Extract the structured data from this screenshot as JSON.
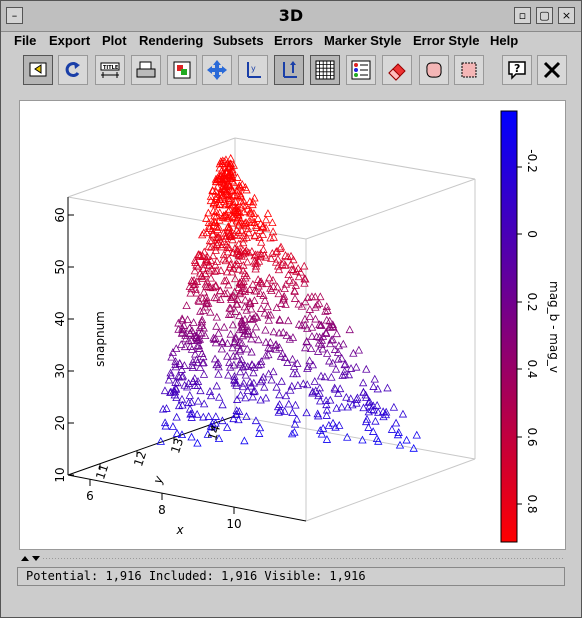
{
  "window": {
    "title": "3D"
  },
  "menu": [
    {
      "label": "File"
    },
    {
      "label": "Export"
    },
    {
      "label": "Plot"
    },
    {
      "label": "Rendering"
    },
    {
      "label": "Subsets"
    },
    {
      "label": "Errors"
    },
    {
      "label": "Marker Style"
    },
    {
      "label": "Error Style"
    },
    {
      "label": "Help"
    }
  ],
  "toolbar": {
    "icons": [
      "exit-icon",
      "replot-icon",
      "axes-title-icon",
      "print-icon",
      "export-image-icon",
      "rotate-icon",
      "axis-y-icon",
      "axis-z-icon",
      "grid-icon",
      "legend-icon",
      "eraser-icon",
      "blob-subset-icon",
      "region-subset-icon",
      "help-icon",
      "close-icon"
    ]
  },
  "plot": {
    "axes": {
      "z_label": "snapnum",
      "z_ticks": [
        "10",
        "20",
        "30",
        "40",
        "50",
        "60"
      ],
      "y_label": "y",
      "y_ticks": [
        "11",
        "12",
        "13",
        "14"
      ],
      "x_label": "x",
      "x_ticks": [
        "6",
        "8",
        "10"
      ]
    },
    "colorbar": {
      "label": "mag_b - mag_v",
      "ticks": [
        "-0.2",
        "0",
        "0.2",
        "0.4",
        "0.6",
        "0.8"
      ],
      "color_low": "#ff0000",
      "color_high": "#0000ff"
    },
    "marker": {
      "shape": "open-triangle"
    }
  },
  "status": {
    "text": "Potential: 1,916 Included: 1,916 Visible: 1,916"
  }
}
